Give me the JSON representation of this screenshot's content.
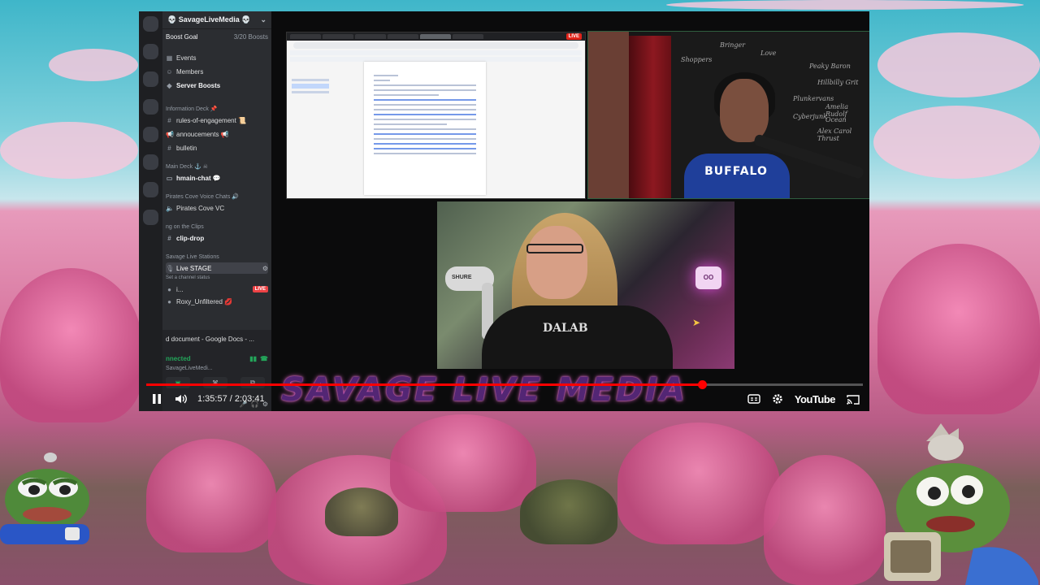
{
  "discord": {
    "server_name": "💀 SavageLiveMedia 💀",
    "boost_goal_label": "Boost Goal",
    "boost_goal_count": "3/20 Boosts",
    "nav_items": [
      "Events",
      "Members",
      "Server Boosts"
    ],
    "category_info": "Information Deck 📌",
    "channels_info": [
      "rules-of-engagement 📜",
      "annoucements 📢",
      "bulletin"
    ],
    "category_main": "Main Deck ⚓ ☠",
    "channel_main": "hmain-chat 💬",
    "category_voice": "Pirates Cove Voice Chats 🔊",
    "channel_voice": "Pirates Cove VC",
    "category_clips": "ng on the Clips",
    "channel_clips": "clip-drop",
    "category_stage": "Savage Live Stations",
    "stage_channel": "Live STAGE",
    "stage_sub": "Set a channel status",
    "live_badge": "LIVE",
    "voice_users": [
      "i...",
      "Roxy_Unfiltered 💋"
    ],
    "doc_title": "d document - Google Docs - ...",
    "connected_label": "nnected",
    "connected_channel": "SavageLiveMedi..."
  },
  "browser": {
    "live_tag": "LIVE"
  },
  "cam1": {
    "shirt_text": "BUFFALO",
    "chalk_words": [
      "Bringer",
      "Shoppers",
      "Love",
      "Peaky Baron",
      "Hillbilly Grit",
      "Plunkervans",
      "Cyberjunk",
      "Amelia Rudolf",
      "Alex Carol Thrust",
      "Ocean"
    ]
  },
  "cam2": {
    "tee_text": "DALAB",
    "mic_label": "SHURE",
    "neon_label": "OO"
  },
  "banner": {
    "text": "SAVAGE LIVE MEDIA"
  },
  "player": {
    "time_label": "1:35:57 / 2:03:41",
    "progress": 0.7758,
    "brand": "YouTube",
    "icons": [
      "pause-icon",
      "volume-icon",
      "captions-icon",
      "settings-icon",
      "cast-icon"
    ]
  },
  "colors": {
    "progress_red": "#ff0000",
    "discord_bg": "#2b2d31",
    "live_red": "#ed4245"
  }
}
